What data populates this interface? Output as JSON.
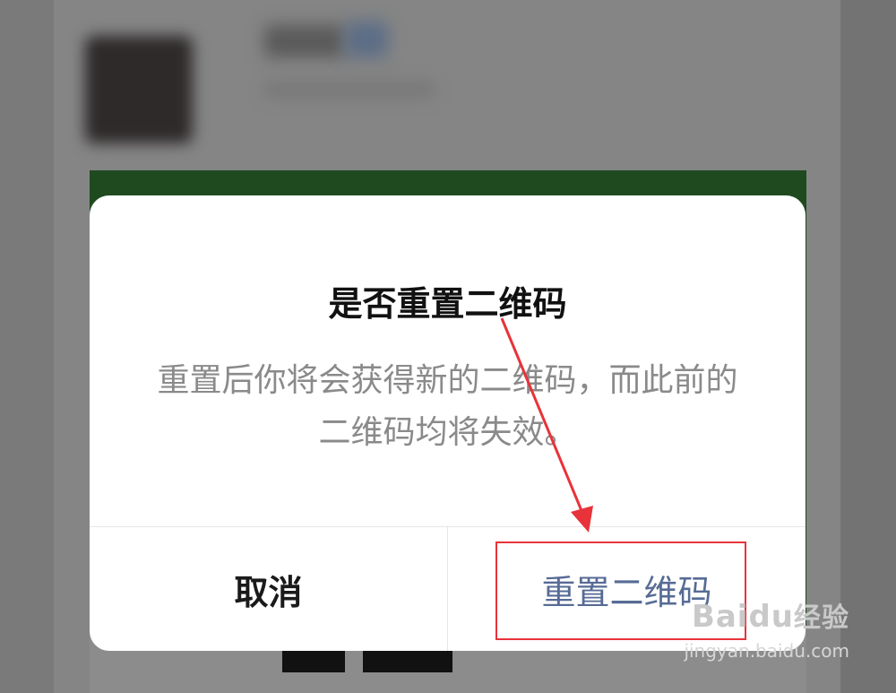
{
  "dialog": {
    "title": "是否重置二维码",
    "message": "重置后你将会获得新的二维码，而此前的二维码均将失效。",
    "cancel_label": "取消",
    "confirm_label": "重置二维码"
  },
  "colors": {
    "confirm_text": "#576b95",
    "annotation_red": "#e8333a",
    "overlay": "#7a7a7a"
  },
  "watermark": {
    "logo": "Baidu",
    "logo_suffix": "经验",
    "url": "jingyan.baidu.com"
  }
}
